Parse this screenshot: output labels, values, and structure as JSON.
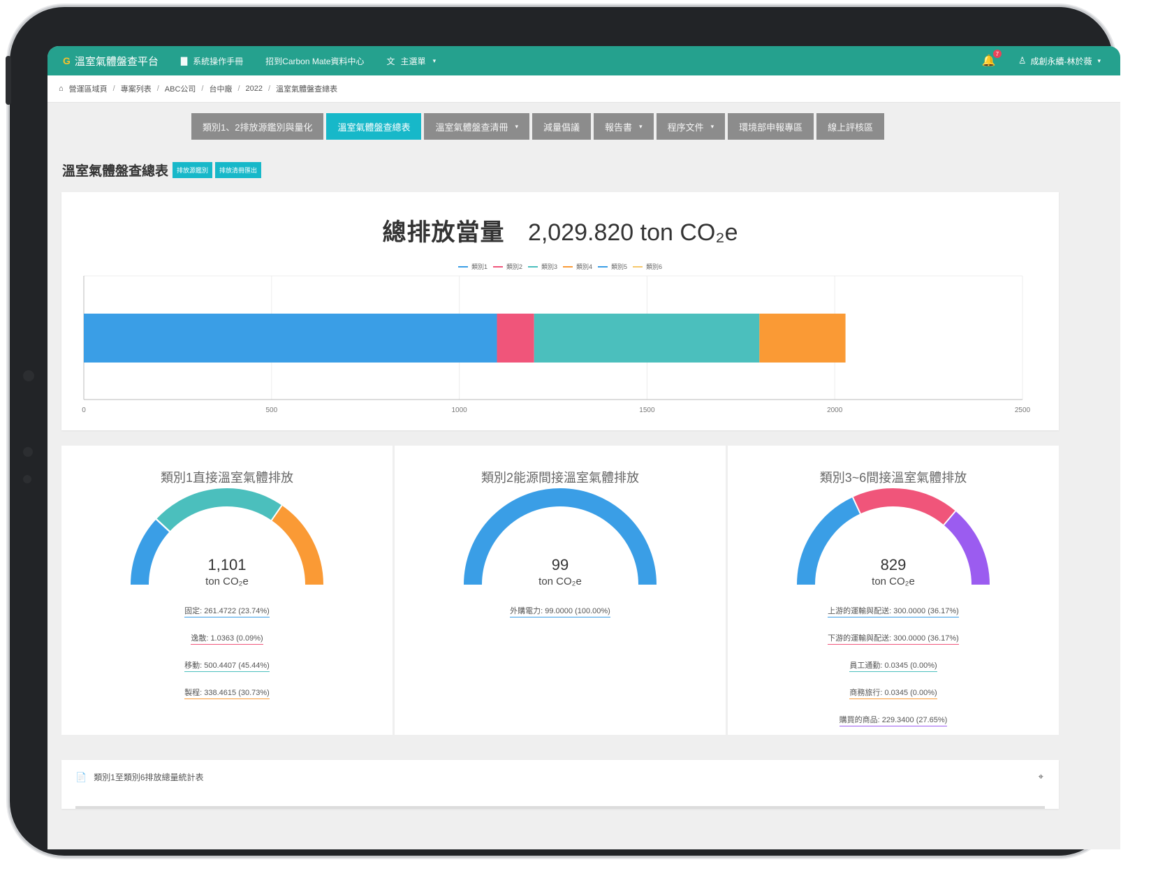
{
  "topbar": {
    "brand": "溫室氣體盤查平台",
    "links": [
      {
        "label": "系統操作手冊",
        "icon": "book-icon"
      },
      {
        "label": "招到Carbon Mate資料中心",
        "icon": ""
      },
      {
        "label": "主選單",
        "icon": "translate-icon"
      }
    ],
    "notifications": "7",
    "user": "成創永續-林於薇"
  },
  "breadcrumb": [
    "營運區域頁",
    "專案列表",
    "ABC公司",
    "台中廠",
    "2022",
    "溫室氣體盤查總表"
  ],
  "tabs": [
    {
      "label": "類別1、2排放源鑑別與量化",
      "active": false,
      "dropdown": false
    },
    {
      "label": "溫室氣體盤查總表",
      "active": true,
      "dropdown": false
    },
    {
      "label": "溫室氣體盤查清冊",
      "active": false,
      "dropdown": true
    },
    {
      "label": "減量倡議",
      "active": false,
      "dropdown": false
    },
    {
      "label": "報告書",
      "active": false,
      "dropdown": true
    },
    {
      "label": "程序文件",
      "active": false,
      "dropdown": true
    },
    {
      "label": "環境部申報專區",
      "active": false,
      "dropdown": false
    },
    {
      "label": "線上評核區",
      "active": false,
      "dropdown": false
    }
  ],
  "page": {
    "title": "溫室氣體盤查總表",
    "buttons": [
      "排放源鑑別",
      "排放清冊匯出"
    ]
  },
  "total": {
    "label": "總排放當量",
    "value": "2,029.820 ton CO₂e"
  },
  "chart_data": {
    "type": "bar",
    "orientation": "horizontal-stacked",
    "categories": [
      ""
    ],
    "series": [
      {
        "name": "類別1",
        "values": [
          1100.3
        ],
        "color": "#3a9ee6"
      },
      {
        "name": "類別2",
        "values": [
          99
        ],
        "color": "#f0557a"
      },
      {
        "name": "類別3",
        "values": [
          600
        ],
        "color": "#4bbfbd"
      },
      {
        "name": "類別4",
        "values": [
          229.3
        ],
        "color": "#fa9a35"
      },
      {
        "name": "類別5",
        "values": [
          0
        ],
        "color": "#3a9ee6"
      },
      {
        "name": "類別6",
        "values": [
          0
        ],
        "color": "#f7c86a"
      }
    ],
    "xlim": [
      0,
      2500
    ],
    "xticks": [
      "0",
      "500",
      "1000",
      "1500",
      "2000",
      "2500"
    ],
    "grid": true,
    "legend": "top-center"
  },
  "gauges": [
    {
      "title": "類別1直接溫室氣體排放",
      "value": "1,101",
      "unit": "ton CO₂e",
      "segments": [
        {
          "fraction": 0.2374,
          "color": "#3a9ee6"
        },
        {
          "fraction": 0.0009,
          "color": "#f0557a"
        },
        {
          "fraction": 0.4544,
          "color": "#4bbfbd"
        },
        {
          "fraction": 0.3073,
          "color": "#fa9a35"
        }
      ],
      "items": [
        {
          "label": "固定: 261.4722 (23.74%)",
          "color": "#3a9ee6"
        },
        {
          "label": "逸散: 1.0363 (0.09%)",
          "color": "#f0557a"
        },
        {
          "label": "移動: 500.4407 (45.44%)",
          "color": "#4bbfbd"
        },
        {
          "label": "製程: 338.4615 (30.73%)",
          "color": "#fa9a35"
        }
      ]
    },
    {
      "title": "類別2能源間接溫室氣體排放",
      "value": "99",
      "unit": "ton CO₂e",
      "segments": [
        {
          "fraction": 1.0,
          "color": "#3a9ee6"
        }
      ],
      "items": [
        {
          "label": "外購電力: 99.0000 (100.00%)",
          "color": "#3a9ee6"
        }
      ]
    },
    {
      "title": "類別3~6間接溫室氣體排放",
      "value": "829",
      "unit": "ton CO₂e",
      "segments": [
        {
          "fraction": 0.3617,
          "color": "#3a9ee6"
        },
        {
          "fraction": 0.3617,
          "color": "#f0557a"
        },
        {
          "fraction": 0.0,
          "color": "#4bbfbd"
        },
        {
          "fraction": 0.0,
          "color": "#fa9a35"
        },
        {
          "fraction": 0.2765,
          "color": "#9b5cf0"
        }
      ],
      "items": [
        {
          "label": "上游的運輸與配送: 300.0000 (36.17%)",
          "color": "#3a9ee6"
        },
        {
          "label": "下游的運輸與配送: 300.0000 (36.17%)",
          "color": "#f0557a"
        },
        {
          "label": "員工通勤: 0.0345 (0.00%)",
          "color": "#4bbfbd"
        },
        {
          "label": "商務旅行: 0.0345 (0.00%)",
          "color": "#fa9a35"
        },
        {
          "label": "購買的商品: 229.3400 (27.65%)",
          "color": "#9b5cf0"
        }
      ]
    }
  ],
  "table": {
    "title": "類別1至類別6排放總量統計表"
  }
}
